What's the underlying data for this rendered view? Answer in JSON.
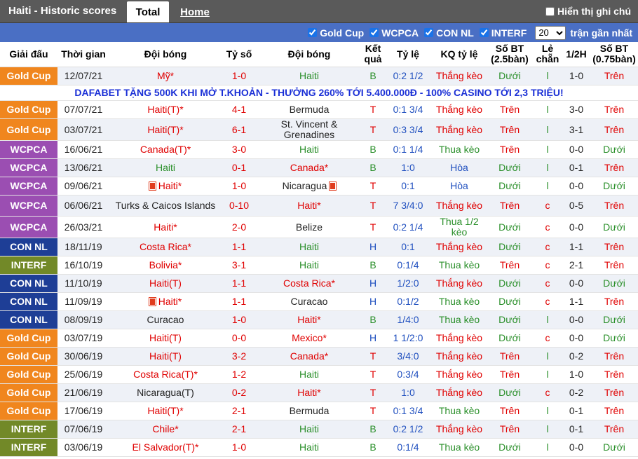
{
  "header": {
    "title": "Haiti - Historic scores",
    "tab_total": "Total",
    "tab_home": "Home",
    "hint": "Hiển thị ghi chú"
  },
  "filters": {
    "items": [
      "Gold Cup",
      "WCPCA",
      "CON NL",
      "INTERF"
    ],
    "count": "20",
    "recent": "trận gần nhất"
  },
  "columns": [
    "Giải đấu",
    "Thời gian",
    "Đội bóng",
    "Tỷ số",
    "Đội bóng",
    "Kết quả",
    "Tỷ lệ",
    "KQ tỷ lệ",
    "Số BT (2.5bàn)",
    "Lẻ chẵn",
    "1/2H",
    "Số BT (0.75bàn)"
  ],
  "ad": "DAFABET TẶNG 500K KHI MỞ T.KHOẢN - THƯỞNG 260% TỚI 5.400.000Đ - 100% CASINO TỚI 2,3 TRIỆU!",
  "colors": {
    "gold": "#f0861e",
    "wcpca": "#9b4eb2",
    "connl": "#1e3e96",
    "interf": "#728928",
    "red": "#e00000",
    "green": "#2a8f2a",
    "blue": "#1f4fbf"
  },
  "rows": [
    {
      "league": "Gold Cup",
      "date": "12/07/21",
      "home": "Mỹ*",
      "score": "1-0",
      "away": "Haiti",
      "result": "B",
      "odds": "0:2 1/2",
      "oddres": "Thắng kèo",
      "ou": "Dưới",
      "oe": "l",
      "half": "1-0",
      "ou2": "Trên"
    },
    {
      "league": "Gold Cup",
      "date": "07/07/21",
      "home": "Haiti(T)*",
      "score": "4-1",
      "away": "Bermuda",
      "result": "T",
      "odds": "0:1 3/4",
      "oddres": "Thắng kèo",
      "ou": "Trên",
      "oe": "l",
      "half": "3-0",
      "ou2": "Trên"
    },
    {
      "league": "Gold Cup",
      "date": "03/07/21",
      "home": "Haiti(T)*",
      "score": "6-1",
      "away": "St. Vincent & Grenadines",
      "result": "T",
      "odds": "0:3 3/4",
      "oddres": "Thắng kèo",
      "ou": "Trên",
      "oe": "l",
      "half": "3-1",
      "ou2": "Trên"
    },
    {
      "league": "WCPCA",
      "date": "16/06/21",
      "home": "Canada(T)*",
      "score": "3-0",
      "away": "Haiti",
      "result": "B",
      "odds": "0:1 1/4",
      "oddres": "Thua kèo",
      "ou": "Trên",
      "oe": "l",
      "half": "0-0",
      "ou2": "Dưới"
    },
    {
      "league": "WCPCA",
      "date": "13/06/21",
      "home": "Haiti",
      "score": "0-1",
      "away": "Canada*",
      "result": "B",
      "odds": "1:0",
      "oddres": "Hòa",
      "ou": "Dưới",
      "oe": "l",
      "half": "0-1",
      "ou2": "Trên"
    },
    {
      "league": "WCPCA",
      "date": "09/06/21",
      "home": "Haiti*",
      "score": "1-0",
      "away": "Nicaragua",
      "result": "T",
      "odds": "0:1",
      "oddres": "Hòa",
      "ou": "Dưới",
      "oe": "l",
      "half": "0-0",
      "ou2": "Dưới"
    },
    {
      "league": "WCPCA",
      "date": "06/06/21",
      "home": "Turks & Caicos Islands",
      "score": "0-10",
      "away": "Haiti*",
      "result": "T",
      "odds": "7 3/4:0",
      "oddres": "Thắng kèo",
      "ou": "Trên",
      "oe": "c",
      "half": "0-5",
      "ou2": "Trên"
    },
    {
      "league": "WCPCA",
      "date": "26/03/21",
      "home": "Haiti*",
      "score": "2-0",
      "away": "Belize",
      "result": "T",
      "odds": "0:2 1/4",
      "oddres": "Thua 1/2 kèo",
      "ou": "Dưới",
      "oe": "c",
      "half": "0-0",
      "ou2": "Dưới"
    },
    {
      "league": "CON NL",
      "date": "18/11/19",
      "home": "Costa Rica*",
      "score": "1-1",
      "away": "Haiti",
      "result": "H",
      "odds": "0:1",
      "oddres": "Thắng kèo",
      "ou": "Dưới",
      "oe": "c",
      "half": "1-1",
      "ou2": "Trên"
    },
    {
      "league": "INTERF",
      "date": "16/10/19",
      "home": "Bolivia*",
      "score": "3-1",
      "away": "Haiti",
      "result": "B",
      "odds": "0:1/4",
      "oddres": "Thua kèo",
      "ou": "Trên",
      "oe": "c",
      "half": "2-1",
      "ou2": "Trên"
    },
    {
      "league": "CON NL",
      "date": "11/10/19",
      "home": "Haiti(T)",
      "score": "1-1",
      "away": "Costa Rica*",
      "result": "H",
      "odds": "1/2:0",
      "oddres": "Thắng kèo",
      "ou": "Dưới",
      "oe": "c",
      "half": "0-0",
      "ou2": "Dưới"
    },
    {
      "league": "CON NL",
      "date": "11/09/19",
      "home": "Haiti*",
      "score": "1-1",
      "away": "Curacao",
      "result": "H",
      "odds": "0:1/2",
      "oddres": "Thua kèo",
      "ou": "Dưới",
      "oe": "c",
      "half": "1-1",
      "ou2": "Trên"
    },
    {
      "league": "CON NL",
      "date": "08/09/19",
      "home": "Curacao",
      "score": "1-0",
      "away": "Haiti*",
      "result": "B",
      "odds": "1/4:0",
      "oddres": "Thua kèo",
      "ou": "Dưới",
      "oe": "l",
      "half": "0-0",
      "ou2": "Dưới"
    },
    {
      "league": "Gold Cup",
      "date": "03/07/19",
      "home": "Haiti(T)",
      "score": "0-0",
      "away": "Mexico*",
      "result": "H",
      "odds": "1 1/2:0",
      "oddres": "Thắng kèo",
      "ou": "Dưới",
      "oe": "c",
      "half": "0-0",
      "ou2": "Dưới"
    },
    {
      "league": "Gold Cup",
      "date": "30/06/19",
      "home": "Haiti(T)",
      "score": "3-2",
      "away": "Canada*",
      "result": "T",
      "odds": "3/4:0",
      "oddres": "Thắng kèo",
      "ou": "Trên",
      "oe": "l",
      "half": "0-2",
      "ou2": "Trên"
    },
    {
      "league": "Gold Cup",
      "date": "25/06/19",
      "home": "Costa Rica(T)*",
      "score": "1-2",
      "away": "Haiti",
      "result": "T",
      "odds": "0:3/4",
      "oddres": "Thắng kèo",
      "ou": "Trên",
      "oe": "l",
      "half": "1-0",
      "ou2": "Trên"
    },
    {
      "league": "Gold Cup",
      "date": "21/06/19",
      "home": "Nicaragua(T)",
      "score": "0-2",
      "away": "Haiti*",
      "result": "T",
      "odds": "1:0",
      "oddres": "Thắng kèo",
      "ou": "Dưới",
      "oe": "c",
      "half": "0-2",
      "ou2": "Trên"
    },
    {
      "league": "Gold Cup",
      "date": "17/06/19",
      "home": "Haiti(T)*",
      "score": "2-1",
      "away": "Bermuda",
      "result": "T",
      "odds": "0:1 3/4",
      "oddres": "Thua kèo",
      "ou": "Trên",
      "oe": "l",
      "half": "0-1",
      "ou2": "Trên"
    },
    {
      "league": "INTERF",
      "date": "07/06/19",
      "home": "Chile*",
      "score": "2-1",
      "away": "Haiti",
      "result": "B",
      "odds": "0:2 1/2",
      "oddres": "Thắng kèo",
      "ou": "Trên",
      "oe": "l",
      "half": "0-1",
      "ou2": "Trên"
    },
    {
      "league": "INTERF",
      "date": "03/06/19",
      "home": "El Salvador(T)*",
      "score": "1-0",
      "away": "Haiti",
      "result": "B",
      "odds": "0:1/4",
      "oddres": "Thua kèo",
      "ou": "Dưới",
      "oe": "l",
      "half": "0-0",
      "ou2": "Dưới"
    }
  ]
}
